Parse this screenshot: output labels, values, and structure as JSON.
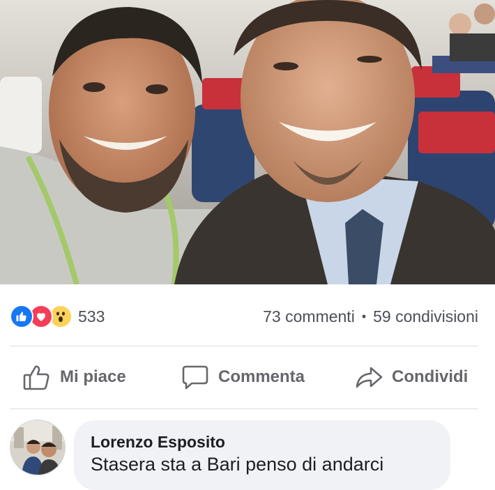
{
  "post": {
    "photo_alt": "selfie-photo"
  },
  "reactions": {
    "icons": [
      "like-icon",
      "love-icon",
      "wow-icon"
    ],
    "count": "533"
  },
  "stats": {
    "comments": "73 commenti",
    "separator": "•",
    "shares": "59 condivisioni"
  },
  "actions": {
    "like_label": "Mi piace",
    "comment_label": "Commenta",
    "share_label": "Condividi"
  },
  "comment": {
    "author": "Lorenzo Esposito",
    "text": "Stasera sta a Bari penso di andarci"
  },
  "colors": {
    "like": "#1877f2",
    "love": "#f33e58",
    "wow": "#fcd25a",
    "action_text": "#65676b",
    "bubble": "#f0f2f5"
  }
}
